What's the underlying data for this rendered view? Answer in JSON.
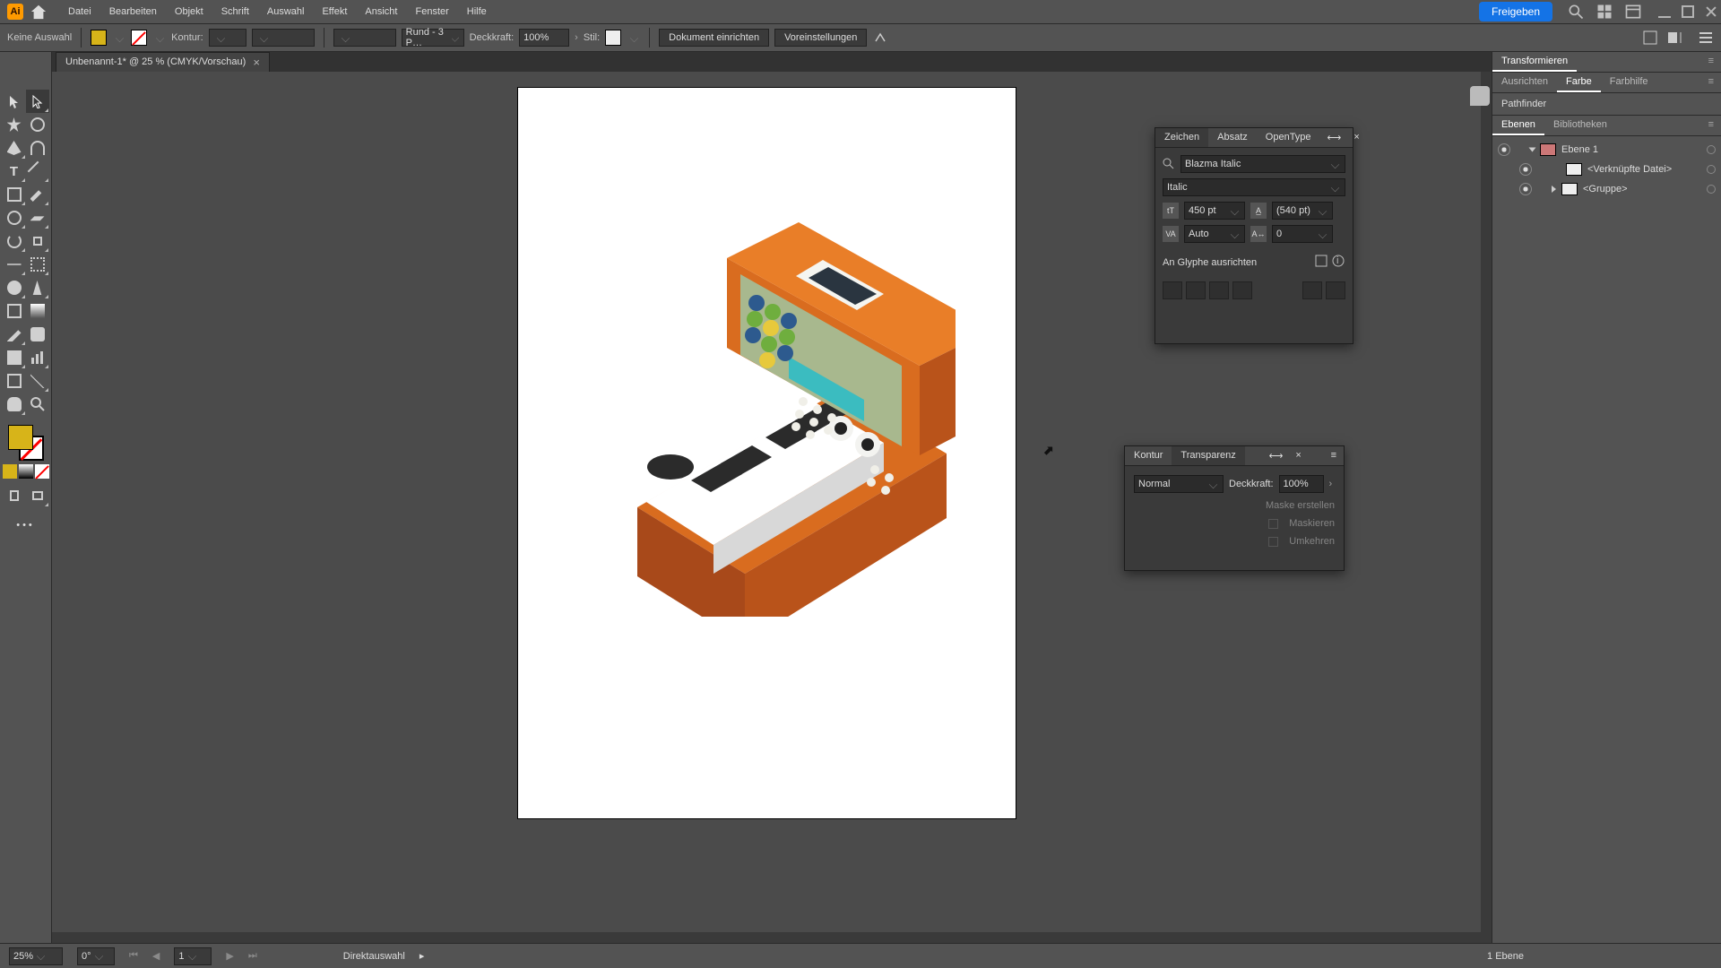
{
  "app": {
    "logo_letter": "Ai"
  },
  "menu": {
    "items": [
      "Datei",
      "Bearbeiten",
      "Objekt",
      "Schrift",
      "Auswahl",
      "Effekt",
      "Ansicht",
      "Fenster",
      "Hilfe"
    ]
  },
  "share": {
    "label": "Freigeben"
  },
  "ctrlbar": {
    "no_selection": "Keine Auswahl",
    "kontur_label": "Kontur:",
    "stroke_profile": "Rund - 3 P…",
    "deckkraft_label": "Deckkraft:",
    "deckkraft_value": "100%",
    "stil_label": "Stil:",
    "doc_setup": "Dokument einrichten",
    "prefs": "Voreinstellungen"
  },
  "doc_tab": {
    "title": "Unbenannt-1* @ 25 % (CMYK/Vorschau)"
  },
  "right_dock": {
    "tab_transform": "Transformieren",
    "tab_align": "Ausrichten",
    "tab_color": "Farbe",
    "tab_colorguide": "Farbhilfe",
    "tab_pathfinder": "Pathfinder",
    "tab_layers": "Ebenen",
    "tab_libraries": "Bibliotheken"
  },
  "layers": {
    "rows": [
      {
        "name": "Ebene 1"
      },
      {
        "name": "<Verknüpfte Datei>"
      },
      {
        "name": "<Gruppe>"
      }
    ]
  },
  "char_panel": {
    "tab_char": "Zeichen",
    "tab_para": "Absatz",
    "tab_otype": "OpenType",
    "font_name": "Blazma Italic",
    "font_style": "Italic",
    "size_value": "450 pt",
    "leading_value": "(540 pt)",
    "kerning_value": "Auto",
    "tracking_value": "0",
    "snap_label": "An Glyphe ausrichten"
  },
  "trans_panel": {
    "tab_stroke": "Kontur",
    "tab_transp": "Transparenz",
    "blend_mode": "Normal",
    "opacity_label": "Deckkraft:",
    "opacity_value": "100%",
    "mask_create": "Maske erstellen",
    "mask_clip": "Maskieren",
    "mask_invert": "Umkehren"
  },
  "status": {
    "zoom": "25%",
    "rotation": "0°",
    "artboard_num": "1",
    "tool_hint": "Direktauswahl",
    "layer_count": "1 Ebene"
  }
}
